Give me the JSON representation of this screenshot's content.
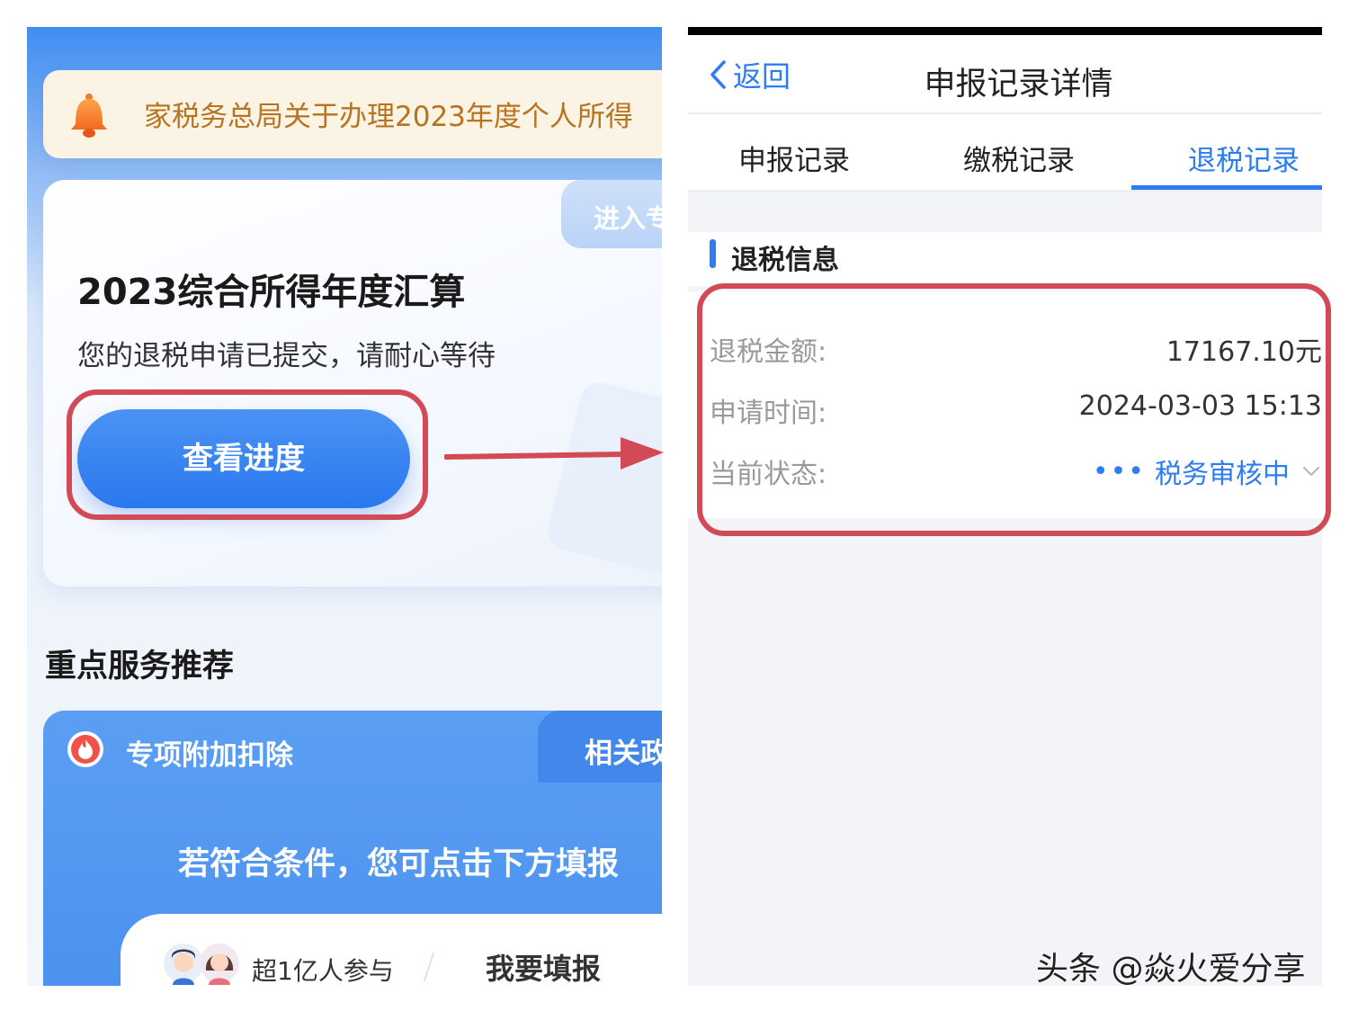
{
  "left": {
    "notice_text": "家税务总局关于办理2023年度个人所得",
    "enter_tab": "进入专",
    "card_title": "2023综合所得年度汇算",
    "card_subtitle": "您的退税申请已提交，请耐心等待",
    "progress_button": "查看进度",
    "section_title": "重点服务推荐",
    "service": {
      "title": "专项附加扣除",
      "tab": "相关政",
      "subtitle": "若符合条件，您可点击下方填报",
      "join_text": "超1亿人参与",
      "fill_button": "我要填报"
    }
  },
  "right": {
    "back_label": "返回",
    "nav_title": "申报记录详情",
    "tabs": [
      {
        "label": "申报记录",
        "active": false
      },
      {
        "label": "缴税记录",
        "active": false
      },
      {
        "label": "退税记录",
        "active": true
      }
    ],
    "section_title": "退税信息",
    "rows": [
      {
        "label": "退税金额:",
        "value": "17167.10元"
      },
      {
        "label": "申请时间:",
        "value": "2024-03-03 15:13"
      },
      {
        "label": "当前状态:",
        "value": "税务审核中"
      }
    ],
    "status_dots": "•••"
  },
  "watermark": "头条 @焱火爱分享",
  "colors": {
    "accent_blue": "#2d7cf0",
    "highlight_red": "#d24a55",
    "notice_text": "#b8731f"
  }
}
